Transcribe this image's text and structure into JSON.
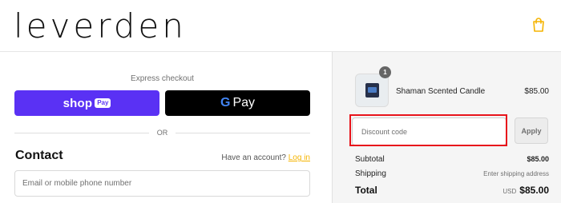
{
  "brand": {
    "logo_text": "leverden",
    "cart_icon": "shopping-bag-icon",
    "accent_color": "#f5b400"
  },
  "express_checkout": {
    "label": "Express checkout",
    "shop_pay": {
      "shop_text": "shop",
      "pay_badge": "Pay",
      "color": "#5a31f4"
    },
    "google_pay": {
      "g_text": "G",
      "pay_text": "Pay"
    },
    "divider_text": "OR"
  },
  "contact": {
    "title": "Contact",
    "account_prompt": "Have an account?",
    "login_link": "Log in",
    "input_placeholder": "Email or mobile phone number"
  },
  "order_summary": {
    "product": {
      "name": "Shaman Scented Candle",
      "price": "$85.00",
      "quantity": "1"
    },
    "discount": {
      "placeholder": "Discount code",
      "apply_label": "Apply",
      "highlight_color": "#e8141b"
    },
    "subtotal": {
      "label": "Subtotal",
      "value": "$85.00"
    },
    "shipping": {
      "label": "Shipping",
      "value": "Enter shipping address"
    },
    "total": {
      "label": "Total",
      "currency": "USD",
      "value": "$85.00"
    }
  }
}
